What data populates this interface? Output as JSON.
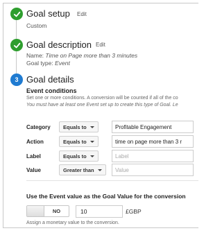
{
  "steps": {
    "setup": {
      "number": "",
      "title": "Goal setup",
      "edit_label": "Edit",
      "value": "Custom"
    },
    "description": {
      "title": "Goal description",
      "edit_label": "Edit",
      "name_label": "Name:",
      "name_value": "Time on Page more than 3 minutes",
      "type_label": "Goal type:",
      "type_value": "Event"
    },
    "details": {
      "number": "3",
      "title": "Goal details"
    }
  },
  "event_conditions": {
    "heading": "Event conditions",
    "help_line": "Set one or more conditions. A conversion will be counted if all of the co",
    "requirement_line": "You must have at least one Event set up to create this type of Goal. Le",
    "rows": [
      {
        "label": "Category",
        "operator": "Equals to",
        "value": "Profitable Engagement",
        "placeholder": ""
      },
      {
        "label": "Action",
        "operator": "Equals to",
        "value": "time on page more than 3 r",
        "placeholder": ""
      },
      {
        "label": "Label",
        "operator": "Equals to",
        "value": "",
        "placeholder": "Label"
      },
      {
        "label": "Value",
        "operator": "Greater than",
        "value": "",
        "placeholder": "Value"
      }
    ]
  },
  "goal_value": {
    "heading": "Use the Event value as the Goal Value for the conversion",
    "toggle_label": "NO",
    "amount": "10",
    "currency": "£GBP",
    "hint": "Assign a monetary value to the conversion."
  },
  "colors": {
    "done": "#2e9e2e",
    "active": "#1f7bd1"
  },
  "icons": {
    "done": "check-icon",
    "dropdown": "caret-down-icon"
  }
}
